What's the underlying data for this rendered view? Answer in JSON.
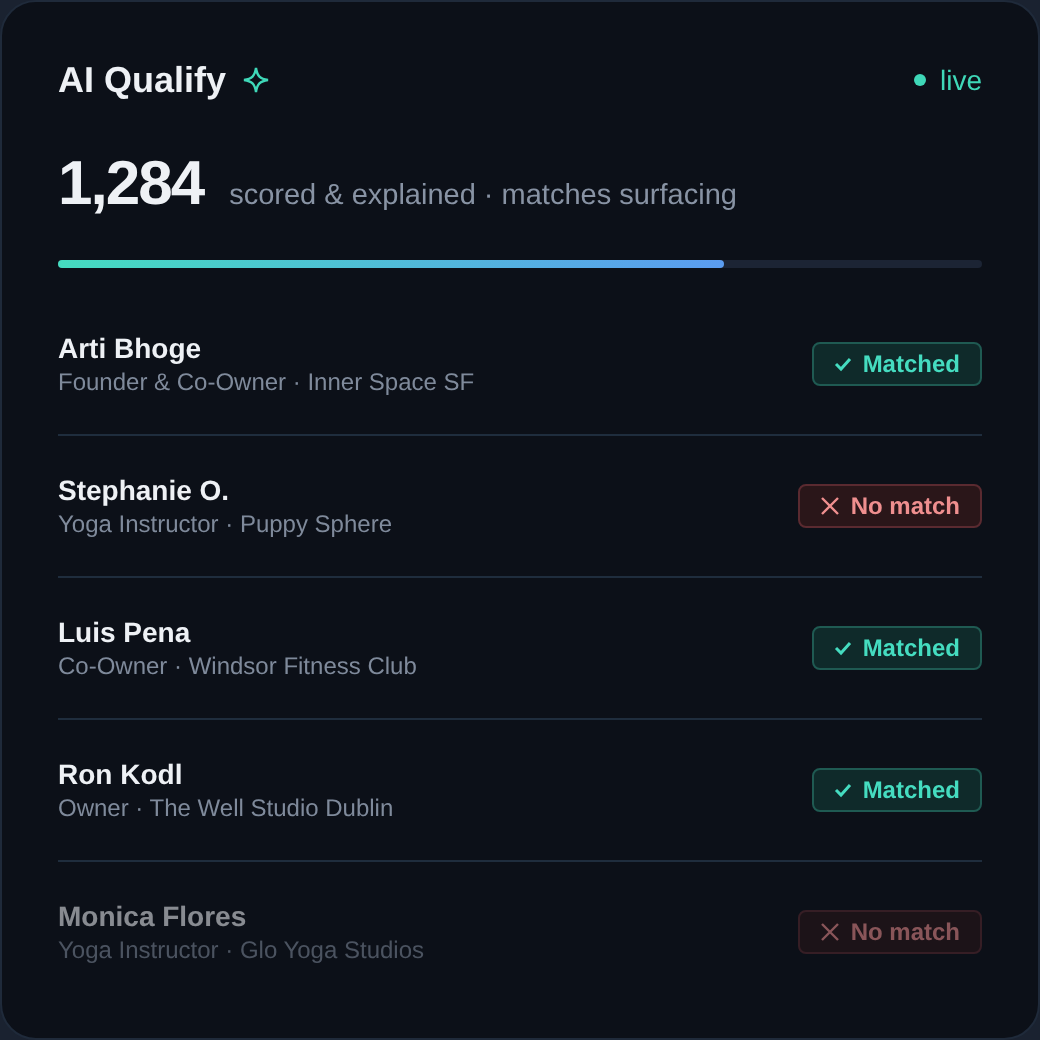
{
  "header": {
    "title": "AI Qualify",
    "status": "live"
  },
  "summary": {
    "count": "1,284",
    "caption": "scored & explained · matches surfacing"
  },
  "progress": {
    "level": 0.72
  },
  "leads": [
    {
      "name": "Arti Bhoge",
      "role": "Founder & Co-Owner · Inner Space SF",
      "result": {
        "kind": "matched",
        "label": "Matched"
      },
      "dimmed": false
    },
    {
      "name": "Stephanie O.",
      "role": "Yoga Instructor · Puppy Sphere",
      "result": {
        "kind": "no_match",
        "label": "No match"
      },
      "dimmed": false
    },
    {
      "name": "Luis Pena",
      "role": "Co-Owner · Windsor Fitness Club",
      "result": {
        "kind": "matched",
        "label": "Matched"
      },
      "dimmed": false
    },
    {
      "name": "Ron Kodl",
      "role": "Owner · The Well Studio Dublin",
      "result": {
        "kind": "matched",
        "label": "Matched"
      },
      "dimmed": false
    },
    {
      "name": "Monica Flores",
      "role": "Yoga Instructor · Glo Yoga Studios",
      "result": {
        "kind": "no_match",
        "label": "No match"
      },
      "dimmed": true
    }
  ]
}
